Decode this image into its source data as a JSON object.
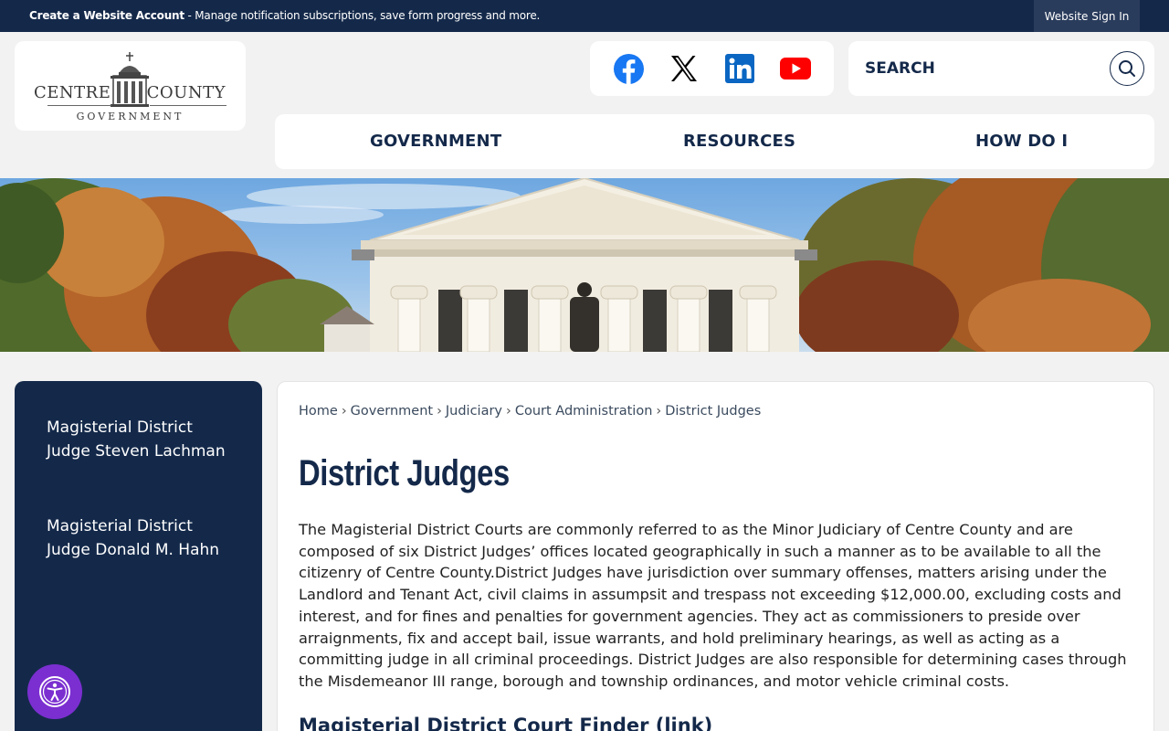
{
  "topbar": {
    "account_link": "Create a Website Account",
    "account_desc": " - Manage notification subscriptions, save form progress and more.",
    "signin": "Website Sign In"
  },
  "logo": {
    "word_left": "CENTRE",
    "word_right": "COUNTY",
    "subtitle": "GOVERNMENT"
  },
  "social": [
    {
      "name": "facebook-icon",
      "color": "#1877f2"
    },
    {
      "name": "x-twitter-icon",
      "color": "#000000"
    },
    {
      "name": "linkedin-icon",
      "color": "#0a66c2"
    },
    {
      "name": "youtube-icon",
      "color": "#ff0000"
    }
  ],
  "search": {
    "placeholder": "SEARCH"
  },
  "nav": {
    "government": "GOVERNMENT",
    "resources": "RESOURCES",
    "how_do_i": "HOW DO I"
  },
  "sidebar": {
    "items": [
      {
        "label": "Magisterial District Judge Steven Lachman"
      },
      {
        "label": "Magisterial District Judge Donald M. Hahn"
      }
    ]
  },
  "breadcrumb": {
    "items": [
      "Home",
      "Government",
      "Judiciary",
      "Court Administration",
      "District Judges"
    ],
    "separator": "›"
  },
  "main": {
    "title": "District Judges",
    "body": "The Magisterial District Courts are commonly referred to as the Minor Judiciary of Centre County and are composed of six District Judges’ offices located geographically in such a manner as to be available to all the citizenry of Centre County.District Judges have jurisdiction over summary offenses, matters arising under the Landlord and Tenant Act, civil claims in assumpsit and trespass not exceeding $12,000.00, excluding costs and interest, and for fines and penalties for government agencies. They act as commissioners to preside over arraignments, fix and accept bail, issue warrants, and hold preliminary hearings, as well as acting as a committing judge in all criminal proceedings. District Judges are also responsible for determining cases through the Misdemeanor III range, borough and township ordinances, and motor vehicle criminal costs.",
    "subheading": "Magisterial District Court Finder (link)"
  },
  "colors": {
    "navy": "#14294a",
    "accessibility_purple": "#7b2fd0"
  }
}
